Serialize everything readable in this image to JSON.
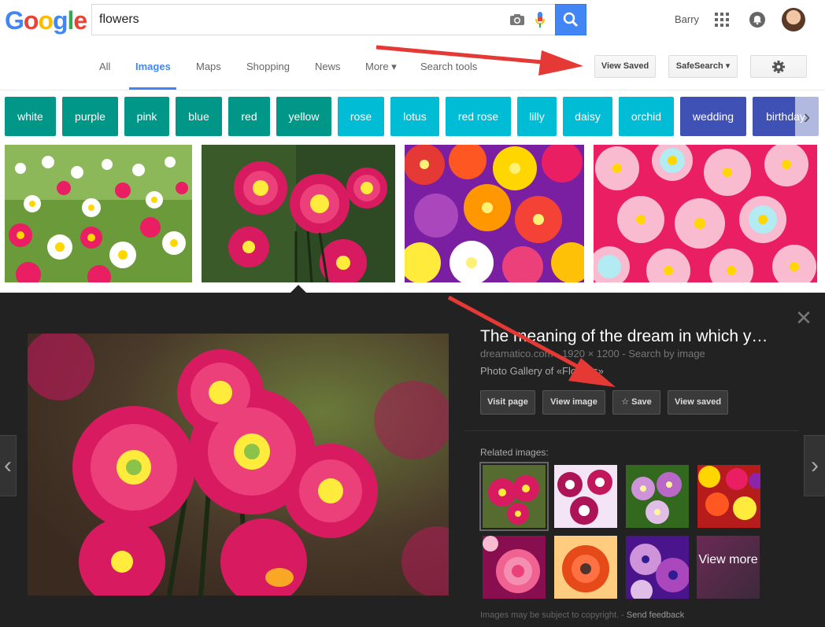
{
  "header": {
    "logo_letters": [
      "G",
      "o",
      "o",
      "g",
      "l",
      "e"
    ],
    "logo_colors": [
      "#4285f4",
      "#ea4335",
      "#fbbc05",
      "#4285f4",
      "#34a853",
      "#ea4335"
    ],
    "search_value": "flowers",
    "username": "Barry"
  },
  "tabs": [
    {
      "label": "All",
      "active": false
    },
    {
      "label": "Images",
      "active": true
    },
    {
      "label": "Maps",
      "active": false
    },
    {
      "label": "Shopping",
      "active": false
    },
    {
      "label": "News",
      "active": false
    },
    {
      "label": "More ▾",
      "active": false
    },
    {
      "label": "Search tools",
      "active": false
    }
  ],
  "tools": {
    "view_saved": "View Saved",
    "safesearch": "SafeSearch ▾"
  },
  "chips": [
    {
      "label": "white",
      "color": "teal"
    },
    {
      "label": "purple",
      "color": "teal"
    },
    {
      "label": "pink",
      "color": "teal"
    },
    {
      "label": "blue",
      "color": "teal"
    },
    {
      "label": "red",
      "color": "teal"
    },
    {
      "label": "yellow",
      "color": "teal"
    },
    {
      "label": "rose",
      "color": "cyan"
    },
    {
      "label": "lotus",
      "color": "cyan"
    },
    {
      "label": "red rose",
      "color": "cyan"
    },
    {
      "label": "lilly",
      "color": "cyan"
    },
    {
      "label": "daisy",
      "color": "cyan"
    },
    {
      "label": "orchid",
      "color": "cyan"
    },
    {
      "label": "wedding",
      "color": "indigo"
    },
    {
      "label": "birthday",
      "color": "indigo"
    }
  ],
  "panel": {
    "title": "The meaning of the dream in which y…",
    "meta": "dreamatico.com - 1920 × 1200 - Search by image",
    "subtitle": "Photo Gallery of «Flowers»",
    "buttons": [
      "Visit page",
      "View image",
      "☆ Save",
      "View saved"
    ],
    "related_label": "Related images:",
    "view_more": "View more",
    "footer_text": "Images may be subject to copyright.",
    "footer_sep": "-",
    "footer_link": "Send feedback"
  }
}
